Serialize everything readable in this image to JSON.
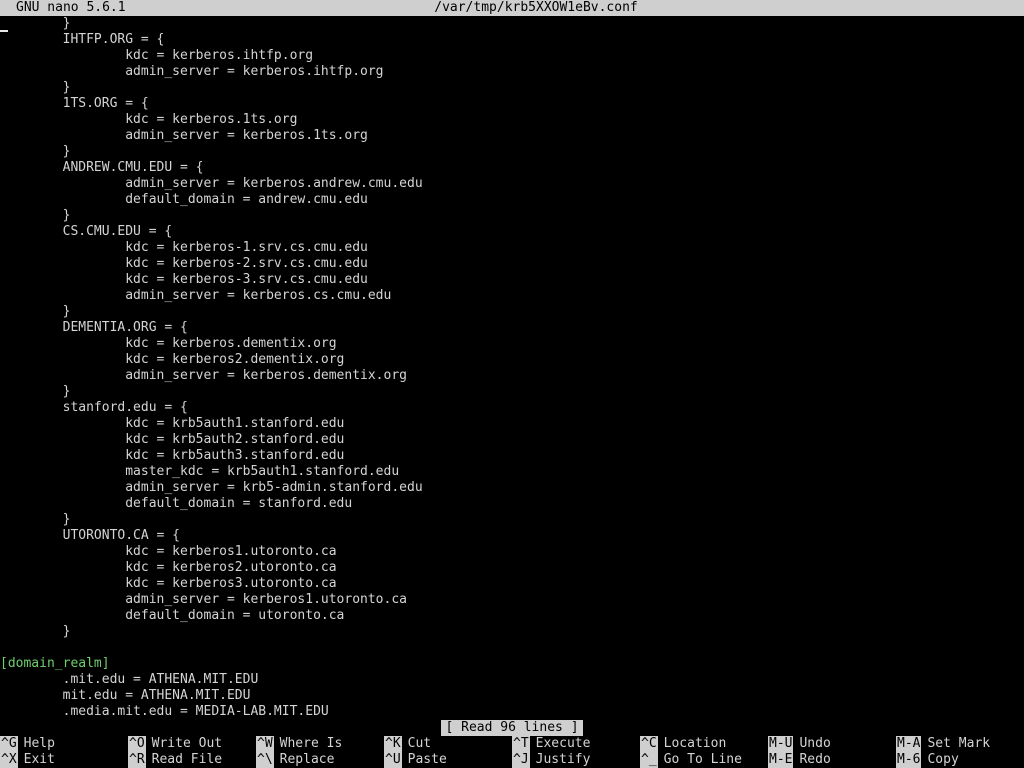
{
  "titlebar": {
    "program": "GNU nano 5.6.1",
    "filename": "/var/tmp/krb5XXOW1eBv.conf"
  },
  "editor": {
    "lines": [
      "        }",
      "        IHTFP.ORG = {",
      "                kdc = kerberos.ihtfp.org",
      "                admin_server = kerberos.ihtfp.org",
      "        }",
      "        1TS.ORG = {",
      "                kdc = kerberos.1ts.org",
      "                admin_server = kerberos.1ts.org",
      "        }",
      "        ANDREW.CMU.EDU = {",
      "                admin_server = kerberos.andrew.cmu.edu",
      "                default_domain = andrew.cmu.edu",
      "        }",
      "        CS.CMU.EDU = {",
      "                kdc = kerberos-1.srv.cs.cmu.edu",
      "                kdc = kerberos-2.srv.cs.cmu.edu",
      "                kdc = kerberos-3.srv.cs.cmu.edu",
      "                admin_server = kerberos.cs.cmu.edu",
      "        }",
      "        DEMENTIA.ORG = {",
      "                kdc = kerberos.dementix.org",
      "                kdc = kerberos2.dementix.org",
      "                admin_server = kerberos.dementix.org",
      "        }",
      "        stanford.edu = {",
      "                kdc = krb5auth1.stanford.edu",
      "                kdc = krb5auth2.stanford.edu",
      "                kdc = krb5auth3.stanford.edu",
      "                master_kdc = krb5auth1.stanford.edu",
      "                admin_server = krb5-admin.stanford.edu",
      "                default_domain = stanford.edu",
      "        }",
      "        UTORONTO.CA = {",
      "                kdc = kerberos1.utoronto.ca",
      "                kdc = kerberos2.utoronto.ca",
      "                kdc = kerberos3.utoronto.ca",
      "                admin_server = kerberos1.utoronto.ca",
      "                default_domain = utoronto.ca",
      "        }",
      "",
      "[domain_realm]",
      "        .mit.edu = ATHENA.MIT.EDU",
      "        mit.edu = ATHENA.MIT.EDU",
      "        .media.mit.edu = MEDIA-LAB.MIT.EDU"
    ],
    "section_line_index": 40,
    "section_color": "#6ecf6e"
  },
  "status": {
    "message": "[ Read 96 lines ]"
  },
  "shortcuts": {
    "row1": [
      {
        "key": "^G",
        "label": "Help"
      },
      {
        "key": "^O",
        "label": "Write Out"
      },
      {
        "key": "^W",
        "label": "Where Is"
      },
      {
        "key": "^K",
        "label": "Cut"
      },
      {
        "key": "^T",
        "label": "Execute"
      },
      {
        "key": "^C",
        "label": "Location"
      },
      {
        "key": "M-U",
        "label": "Undo"
      },
      {
        "key": "M-A",
        "label": "Set Mark"
      }
    ],
    "row2": [
      {
        "key": "^X",
        "label": "Exit"
      },
      {
        "key": "^R",
        "label": "Read File"
      },
      {
        "key": "^\\",
        "label": "Replace"
      },
      {
        "key": "^U",
        "label": "Paste"
      },
      {
        "key": "^J",
        "label": "Justify"
      },
      {
        "key": "^_",
        "label": "Go To Line"
      },
      {
        "key": "M-E",
        "label": "Redo"
      },
      {
        "key": "M-6",
        "label": "Copy"
      }
    ]
  }
}
